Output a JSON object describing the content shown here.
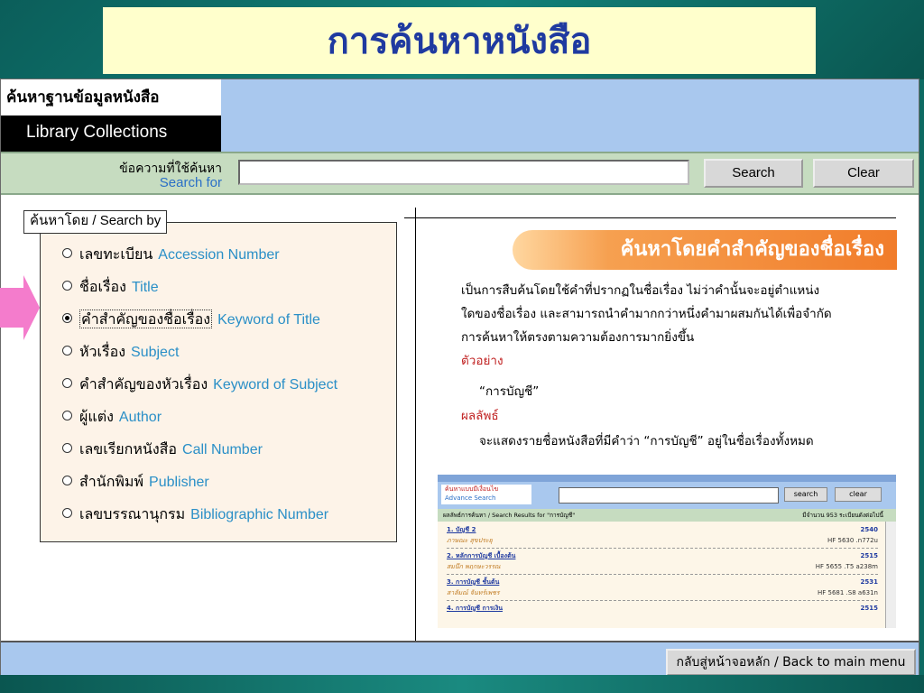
{
  "page": {
    "title": "การค้นหาหนังสือ"
  },
  "header": {
    "label_th": "ค้นหาฐานข้อมูลหนังสือ",
    "label_en": "Library Collections"
  },
  "search": {
    "label_th": "ข้อความที่ใช้ค้นหา",
    "label_en": "Search for",
    "value": "",
    "search_button": "Search",
    "clear_button": "Clear"
  },
  "search_by": {
    "legend": "ค้นหาโดย / Search by",
    "options": [
      {
        "th": "เลขทะเบียน",
        "en": "Accession Number",
        "selected": false
      },
      {
        "th": "ชื่อเรื่อง",
        "en": "Title",
        "selected": false
      },
      {
        "th": "คำสำคัญของชื่อเรื่อง",
        "en": "Keyword of Title",
        "selected": true
      },
      {
        "th": "หัวเรื่อง",
        "en": "Subject",
        "selected": false
      },
      {
        "th": "คำสำคัญของหัวเรื่อง",
        "en": "Keyword of Subject",
        "selected": false
      },
      {
        "th": "ผู้แต่ง",
        "en": "Author",
        "selected": false
      },
      {
        "th": "เลขเรียกหนังสือ",
        "en": "Call Number",
        "selected": false
      },
      {
        "th": "สำนักพิมพ์",
        "en": "Publisher",
        "selected": false
      },
      {
        "th": "เลขบรรณานุกรม",
        "en": "Bibliographic Number",
        "selected": false
      }
    ]
  },
  "info": {
    "heading": "ค้นหาโดยคำสำคัญของชื่อเรื่อง",
    "line1": "เป็นการสืบค้นโดยใช้คำที่ปรากฏในชื่อเรื่อง  ไม่ว่าคำนั้นจะอยู่ตำแหน่ง",
    "line2": "ใดของชื่อเรื่อง และสามารถนำคำมากกว่าหนึ่งคำมาผสมกันได้เพื่อจำกัด",
    "line3": "การค้นหาให้ตรงตามความต้องการมากยิ่งขึ้น",
    "example_label": "ตัวอย่าง",
    "example": "“การบัญชี”",
    "result_label": "ผลลัพธ์",
    "result": "จะแสดงรายชื่อหนังสือที่มีคำว่า “การบัญชี” อยู่ในชื่อเรื่องทั้งหมด"
  },
  "preview": {
    "label_th": "ค้นหาแบบมีเงื่อนไข",
    "label_en": "Advance Search",
    "search_button": "search",
    "clear_button": "clear",
    "results_label": "ผลลัพธ์การค้นหา / Search Results for  \"การบัญชี\"",
    "count_text": "มีจำนวน 953 ระเบียนดังต่อไปนี้",
    "results": [
      {
        "title": "1. บัญชี 2",
        "number": "2540",
        "author": "ภาษณะ สุขประยุ",
        "call": "HF 5630 .n772u"
      },
      {
        "title": "2. หลักการบัญชี เบื้องต้น",
        "number": "2515",
        "author": "สมนึก พฤกษะวรรณ",
        "call": "HF 5655 .T5 a238m"
      },
      {
        "title": "3. การบัญชี ชั้นต้น",
        "number": "2531",
        "author": "สาลัมณ์ จันทร์เพชร",
        "call": "HF 5681 .S8 a631n"
      },
      {
        "title": "4. การบัญชี การเงิน",
        "number": "2515",
        "author": "",
        "call": ""
      }
    ]
  },
  "footer": {
    "back_button": "กลับสู่หน้าจอหลัก / Back to main menu"
  },
  "colors": {
    "accent_blue": "#1f3aa0",
    "header_bg": "#a9c8ee",
    "highlight": "#f17c2a",
    "arrow": "#f47ccc"
  }
}
